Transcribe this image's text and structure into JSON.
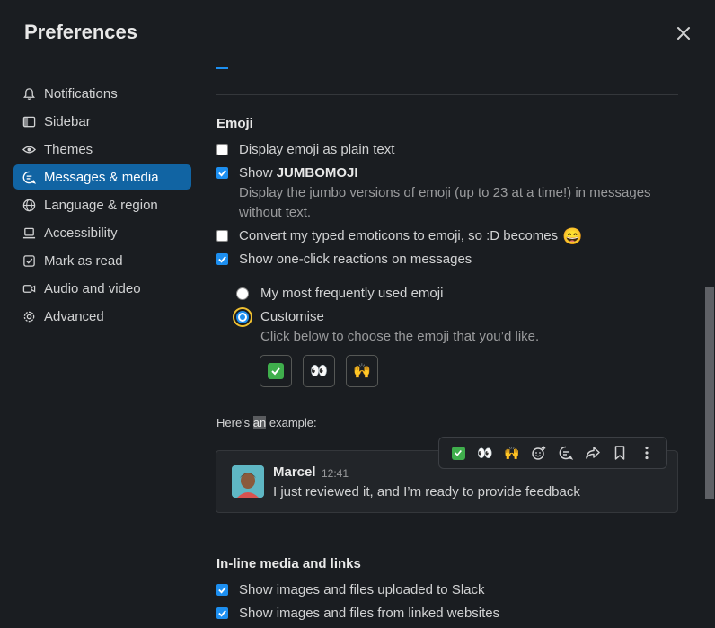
{
  "title": "Preferences",
  "sidebar": {
    "items": [
      {
        "label": "Notifications",
        "icon": "bell-icon"
      },
      {
        "label": "Sidebar",
        "icon": "sidebar-icon"
      },
      {
        "label": "Themes",
        "icon": "eye-icon"
      },
      {
        "label": "Messages & media",
        "icon": "message-icon",
        "active": true
      },
      {
        "label": "Language & region",
        "icon": "globe-icon"
      },
      {
        "label": "Accessibility",
        "icon": "laptop-icon"
      },
      {
        "label": "Mark as read",
        "icon": "checkbox-icon"
      },
      {
        "label": "Audio and video",
        "icon": "video-icon"
      },
      {
        "label": "Advanced",
        "icon": "gear-icon"
      }
    ]
  },
  "emoji": {
    "title": "Emoji",
    "plain_text": {
      "label": "Display emoji as plain text",
      "checked": false
    },
    "jumbomoji": {
      "label_prefix": "Show ",
      "label_bold": "JUMBOMOJI",
      "checked": true,
      "help_line1": "Display the jumbo versions of emoji (up to 23 at a time!) in messages",
      "help_line2": "without text."
    },
    "convert": {
      "label": "Convert my typed emoticons to emoji, so :D becomes",
      "emoji": "😄",
      "checked": false
    },
    "one_click": {
      "label": "Show one-click reactions on messages",
      "checked": true
    },
    "radio_frequent": {
      "label": "My most frequently used emoji",
      "selected": false
    },
    "radio_custom": {
      "label": "Customise",
      "selected": true
    },
    "custom_help": "Click below to choose the emoji that you’d like.",
    "custom_emojis": [
      "✅",
      "👀",
      "🙌"
    ]
  },
  "example": {
    "label_prefix": "Here's ",
    "label_highlight": "an",
    "label_suffix": " example:",
    "author": "Marcel",
    "time": "12:41",
    "text": "I just reviewed it, and I’m ready to provide feedback",
    "toolbar_emojis": [
      "✅",
      "👀",
      "🙌"
    ]
  },
  "inline_media": {
    "title": "In-line media and links",
    "uploaded": {
      "label": "Show images and files uploaded to Slack",
      "checked": true
    },
    "linked": {
      "label": "Show images and files from linked websites",
      "checked": true
    }
  },
  "colors": {
    "accent": "#1164a3",
    "checkbox": "#1d8ff0",
    "focus_ring": "#f0c030"
  }
}
